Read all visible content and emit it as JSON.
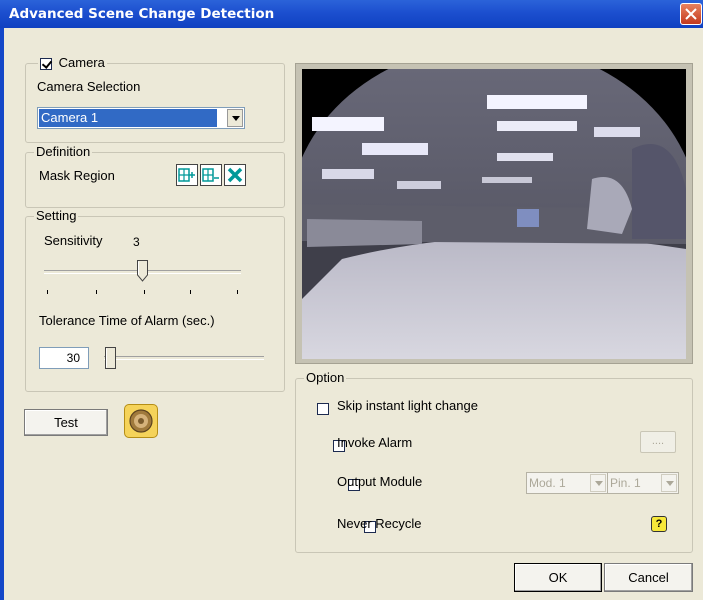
{
  "window": {
    "title": "Advanced Scene Change Detection"
  },
  "camera_group": {
    "legend": "Camera",
    "checked": true,
    "selection_label": "Camera Selection",
    "selected": "Camera 1"
  },
  "definition_group": {
    "legend": "Definition",
    "mask_region_label": "Mask Region",
    "icons": [
      "add-mask-icon",
      "remove-mask-icon",
      "clear-mask-icon"
    ]
  },
  "setting_group": {
    "legend": "Setting",
    "sensitivity_label": "Sensitivity",
    "sensitivity_value": "3",
    "sensitivity_min": 1,
    "sensitivity_max": 5,
    "tolerance_label": "Tolerance Time of Alarm (sec.)",
    "tolerance_value": "30",
    "tolerance_fraction": 0
  },
  "test": {
    "label": "Test"
  },
  "option_group": {
    "legend": "Option",
    "skip_light": "Skip instant light change",
    "invoke_alarm": "Invoke Alarm",
    "browse_label": "....",
    "output_module": "Output Module",
    "module_value": "Mod. 1",
    "pin_value": "Pin. 1",
    "never_recycle": "Never Recycle"
  },
  "footer": {
    "ok": "OK",
    "cancel": "Cancel"
  },
  "colors": {
    "titlebar": "#1c4fcf",
    "selection": "#316ac5",
    "window_bg": "#ece9d8"
  }
}
